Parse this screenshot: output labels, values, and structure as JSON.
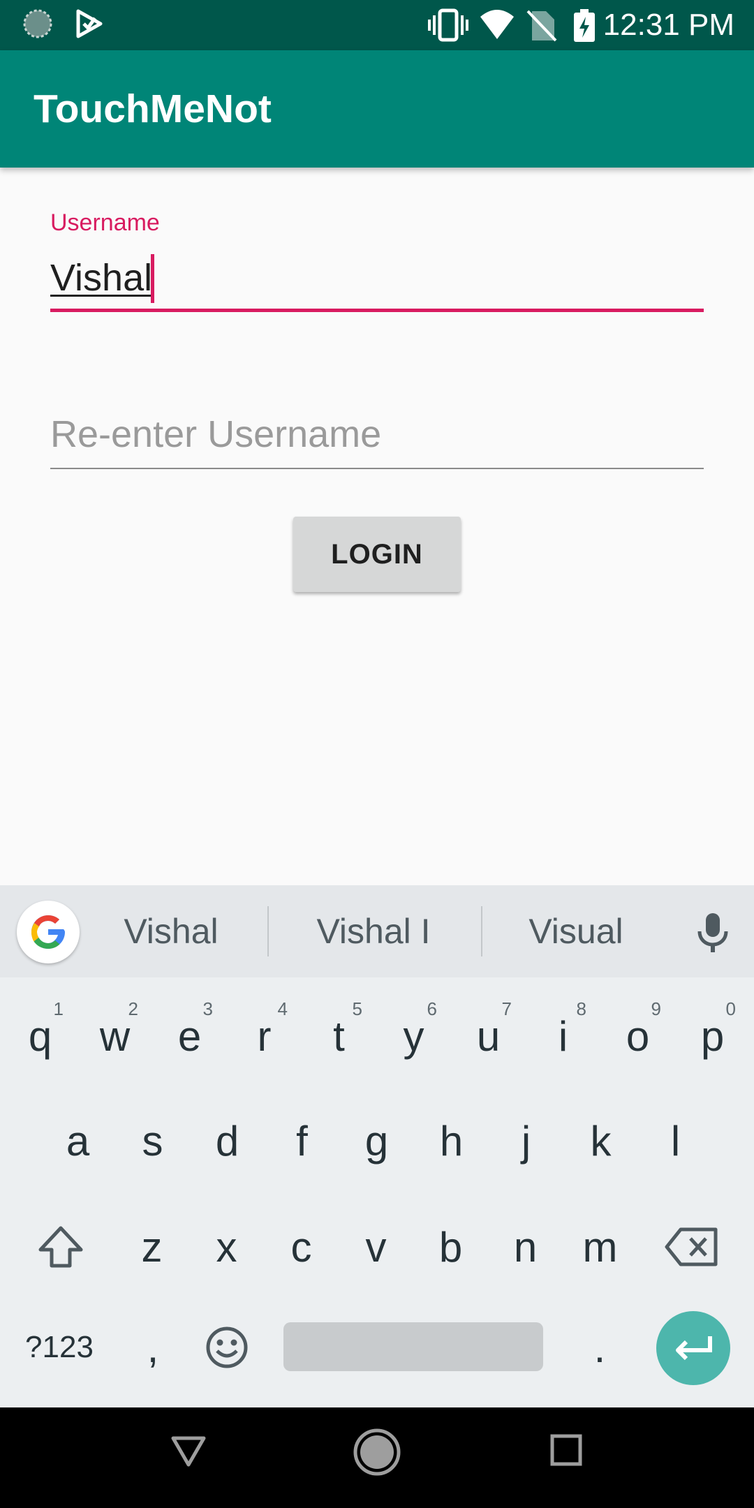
{
  "status_bar": {
    "time": "12:31 PM",
    "icons": [
      "loading-icon",
      "play-store-icon",
      "vibrate-icon",
      "wifi-icon",
      "no-sim-icon",
      "battery-charging-icon"
    ]
  },
  "app_bar": {
    "title": "TouchMeNot"
  },
  "form": {
    "username_label": "Username",
    "username_value": "Vishal",
    "reenter_placeholder": "Re-enter Username",
    "login_label": "LOGIN"
  },
  "keyboard": {
    "suggestions": [
      "Vishal",
      "Vishal I",
      "Visual"
    ],
    "row1": [
      {
        "key": "q",
        "hint": "1"
      },
      {
        "key": "w",
        "hint": "2"
      },
      {
        "key": "e",
        "hint": "3"
      },
      {
        "key": "r",
        "hint": "4"
      },
      {
        "key": "t",
        "hint": "5"
      },
      {
        "key": "y",
        "hint": "6"
      },
      {
        "key": "u",
        "hint": "7"
      },
      {
        "key": "i",
        "hint": "8"
      },
      {
        "key": "o",
        "hint": "9"
      },
      {
        "key": "p",
        "hint": "0"
      }
    ],
    "row2": [
      "a",
      "s",
      "d",
      "f",
      "g",
      "h",
      "j",
      "k",
      "l"
    ],
    "row3": [
      "z",
      "x",
      "c",
      "v",
      "b",
      "n",
      "m"
    ],
    "symbols_label": "?123",
    "comma": ",",
    "period": ".",
    "colors": {
      "enter": "#4db6ac",
      "accent": "#d81b60",
      "app_bar": "#008577"
    }
  },
  "nav_bar": {
    "buttons": [
      "back-icon",
      "home-icon",
      "recents-icon"
    ]
  }
}
